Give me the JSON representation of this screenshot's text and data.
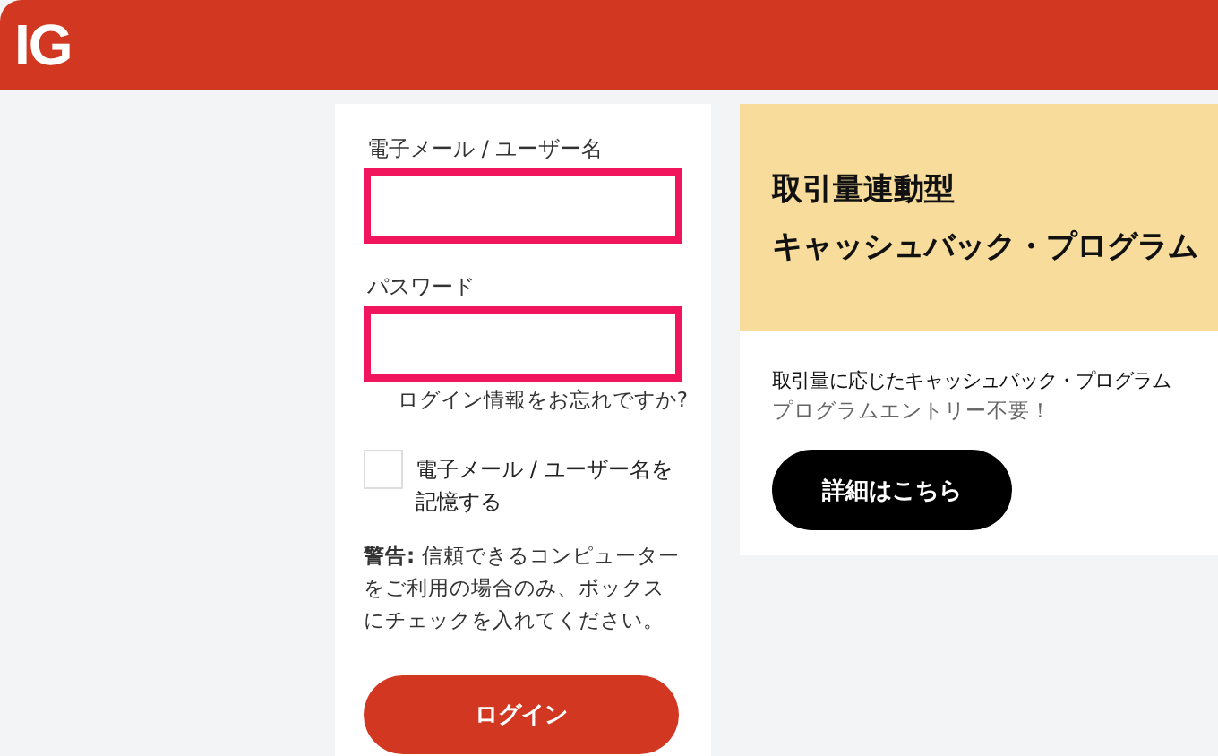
{
  "header": {
    "logo": "IG"
  },
  "login_form": {
    "fields": [
      {
        "label": "電子メール / ユーザー名",
        "highlighted": true
      },
      {
        "label": "パスワード",
        "highlighted": true
      }
    ],
    "forgot_link": "ログイン情報をお忘れですか?",
    "remember": {
      "label": "電子メール / ユーザー名を記憶する",
      "checked": false
    },
    "warning": "**警告:** 信頼できるコンピューターをご利用の場合のみ、ボックスにチェックを入れてください。",
    "submit_button": "ログイン"
  },
  "promo": {
    "title_lines": [
      "取引量連動型",
      "キャッシュバック・プログラム"
    ],
    "description": "取引量に応じたキャッシュバック・プログラム",
    "note": "プログラムエントリー不要！",
    "button": "詳細はこちら"
  }
}
